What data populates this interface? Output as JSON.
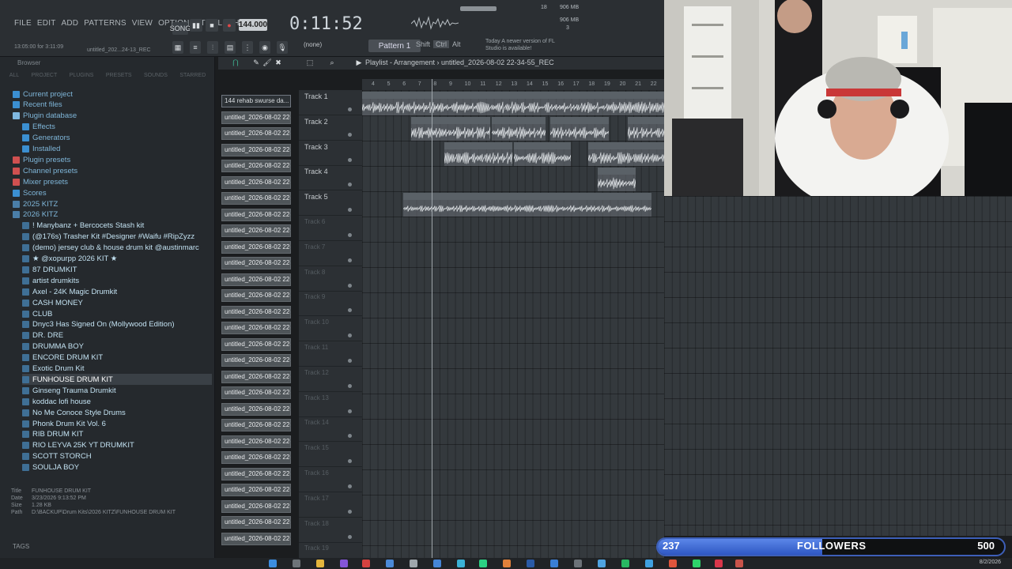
{
  "app": {
    "menu": [
      "FILE",
      "EDIT",
      "ADD",
      "PATTERNS",
      "VIEW",
      "OPTIONS",
      "TOOLS",
      "HELP"
    ],
    "song_mode": "SONG",
    "bpm": "144.000",
    "time": "0:11:52",
    "memo": "13:05:00 for 3:11:09",
    "hint_title": "untitled_202...24-13_REC",
    "snap": "(none)",
    "pattern": "Pattern 1",
    "mod_keys": [
      "Shift",
      "Ctrl",
      "Alt"
    ],
    "update_notice": "Today  A newer version of FL Studio is available!",
    "cpu": "18",
    "mem1": "906 MB",
    "mem2": "906 MB",
    "poly": "3"
  },
  "browser": {
    "header": "Browser",
    "tabs": [
      "ALL",
      "PROJECT",
      "PLUGINS",
      "PRESETS",
      "SOUNDS",
      "STARRED"
    ],
    "items": [
      {
        "label": "Current project",
        "type": "root",
        "color": "#3b8fd1"
      },
      {
        "label": "Recent files",
        "type": "root",
        "color": "#3b8fd1"
      },
      {
        "label": "Plugin database",
        "type": "root",
        "color": "#7fb8e0"
      },
      {
        "label": "Effects",
        "type": "sub",
        "color": "#3b8fd1"
      },
      {
        "label": "Generators",
        "type": "sub",
        "color": "#3b8fd1"
      },
      {
        "label": "Installed",
        "type": "sub",
        "color": "#3b8fd1"
      },
      {
        "label": "Plugin presets",
        "type": "root",
        "color": "#d05050"
      },
      {
        "label": "Channel presets",
        "type": "root",
        "color": "#d05050"
      },
      {
        "label": "Mixer presets",
        "type": "root",
        "color": "#d05050"
      },
      {
        "label": "Scores",
        "type": "root",
        "color": "#3b8fd1"
      },
      {
        "label": "2025 KITZ",
        "type": "root",
        "color": "#4a7ea8"
      },
      {
        "label": "2026 KITZ",
        "type": "root",
        "color": "#4a7ea8"
      },
      {
        "label": "! Manybanz + Bercocets Stash kit",
        "type": "kit"
      },
      {
        "label": "(@176s) Trasher Kit #Designer #Waifu #RipZyzz",
        "type": "kit"
      },
      {
        "label": "(demo) jersey club & house drum kit @austinmarc",
        "type": "kit"
      },
      {
        "label": "★ @xopurpp 2026 KIT ★",
        "type": "kit"
      },
      {
        "label": "87 DRUMKIT",
        "type": "kit"
      },
      {
        "label": "artist drumkits",
        "type": "kit"
      },
      {
        "label": "Axel - 24K Magic Drumkit",
        "type": "kit"
      },
      {
        "label": "CASH MONEY",
        "type": "kit"
      },
      {
        "label": "CLUB",
        "type": "kit"
      },
      {
        "label": "Dnyc3 Has Signed On (Mollywood Edition)",
        "type": "kit"
      },
      {
        "label": "DR. DRE",
        "type": "kit"
      },
      {
        "label": "DRUMMA BOY",
        "type": "kit"
      },
      {
        "label": "ENCORE DRUM KIT",
        "type": "kit"
      },
      {
        "label": "Exotic Drum Kit",
        "type": "kit"
      },
      {
        "label": "FUNHOUSE DRUM KIT",
        "type": "kit",
        "selected": true
      },
      {
        "label": "Ginseng Trauma Drumkit",
        "type": "kit"
      },
      {
        "label": "koddac lofi house",
        "type": "kit"
      },
      {
        "label": "No Me Conoce Style Drums",
        "type": "kit"
      },
      {
        "label": "Phonk Drum Kit Vol. 6",
        "type": "kit"
      },
      {
        "label": "RIB DRUM KIT",
        "type": "kit"
      },
      {
        "label": "RIO LEYVA 25K YT DRUMKIT",
        "type": "kit"
      },
      {
        "label": "SCOTT STORCH",
        "type": "kit"
      },
      {
        "label": "SOULJA BOY",
        "type": "kit"
      }
    ],
    "info": {
      "title_key": "Title",
      "title": "FUNHOUSE DRUM KIT",
      "date_key": "Date",
      "date": "3/23/2026 9:13:52 PM",
      "size_key": "Size",
      "size": "1.28 KB",
      "path_key": "Path",
      "path": "D:\\BACKUP\\Drum Kits\\2026 KITZ\\FUNHOUSE DRUM KIT"
    },
    "tags_label": "TAGS"
  },
  "cliplist": {
    "first": "144 rehab swurse da...",
    "item": "untitled_2026-08-02 22-",
    "count": 28
  },
  "playlist": {
    "title": "Playlist - Arrangement  ›  untitled_2026-08-02 22-34-55_REC",
    "ruler": [
      "4",
      "5",
      "6",
      "7",
      "8",
      "9",
      "10",
      "11",
      "12",
      "13",
      "14",
      "15",
      "16",
      "17",
      "18",
      "19",
      "20",
      "21",
      "22"
    ],
    "tracks": [
      "Track 1",
      "Track 2",
      "Track 3",
      "Track 4",
      "Track 5",
      "Track 6",
      "Track 7",
      "Track 8",
      "Track 9",
      "Track 10",
      "Track 11",
      "Track 12",
      "Track 13",
      "Track 14",
      "Track 15",
      "Track 16",
      "Track 17",
      "Track 18",
      "Track 19"
    ],
    "audio_clips": [
      {
        "label": "144 rehab swurse darko",
        "track": 0
      },
      {
        "label": "untitled_202...23-39_REC",
        "track": 1
      },
      {
        "label": "untitled...-05_REC",
        "track": 1
      },
      {
        "label": "untitled_2...24-24_REC",
        "track": 1
      },
      {
        "label": "untitled_202",
        "track": 1
      },
      {
        "label": "untitled_20...23-47_REC",
        "track": 2
      },
      {
        "label": "untitled_2...4-13_REC",
        "track": 2
      },
      {
        "label": "untitled_2026-...22-27-20_R",
        "track": 2
      },
      {
        "label": "untitl...2_REC",
        "track": 3
      },
      {
        "label": "untitled_2026-08-02 22-34-55_REC",
        "track": 4
      }
    ]
  },
  "followers": {
    "current": "237",
    "label": "FOLLOWERS",
    "goal": "500",
    "progress": 0.474
  },
  "taskbar": {
    "date": "8/2/2026"
  },
  "colors": {
    "accent": "#3d5fb8",
    "clip_bg": "#4f5559",
    "grid_bg": "#34393d"
  }
}
